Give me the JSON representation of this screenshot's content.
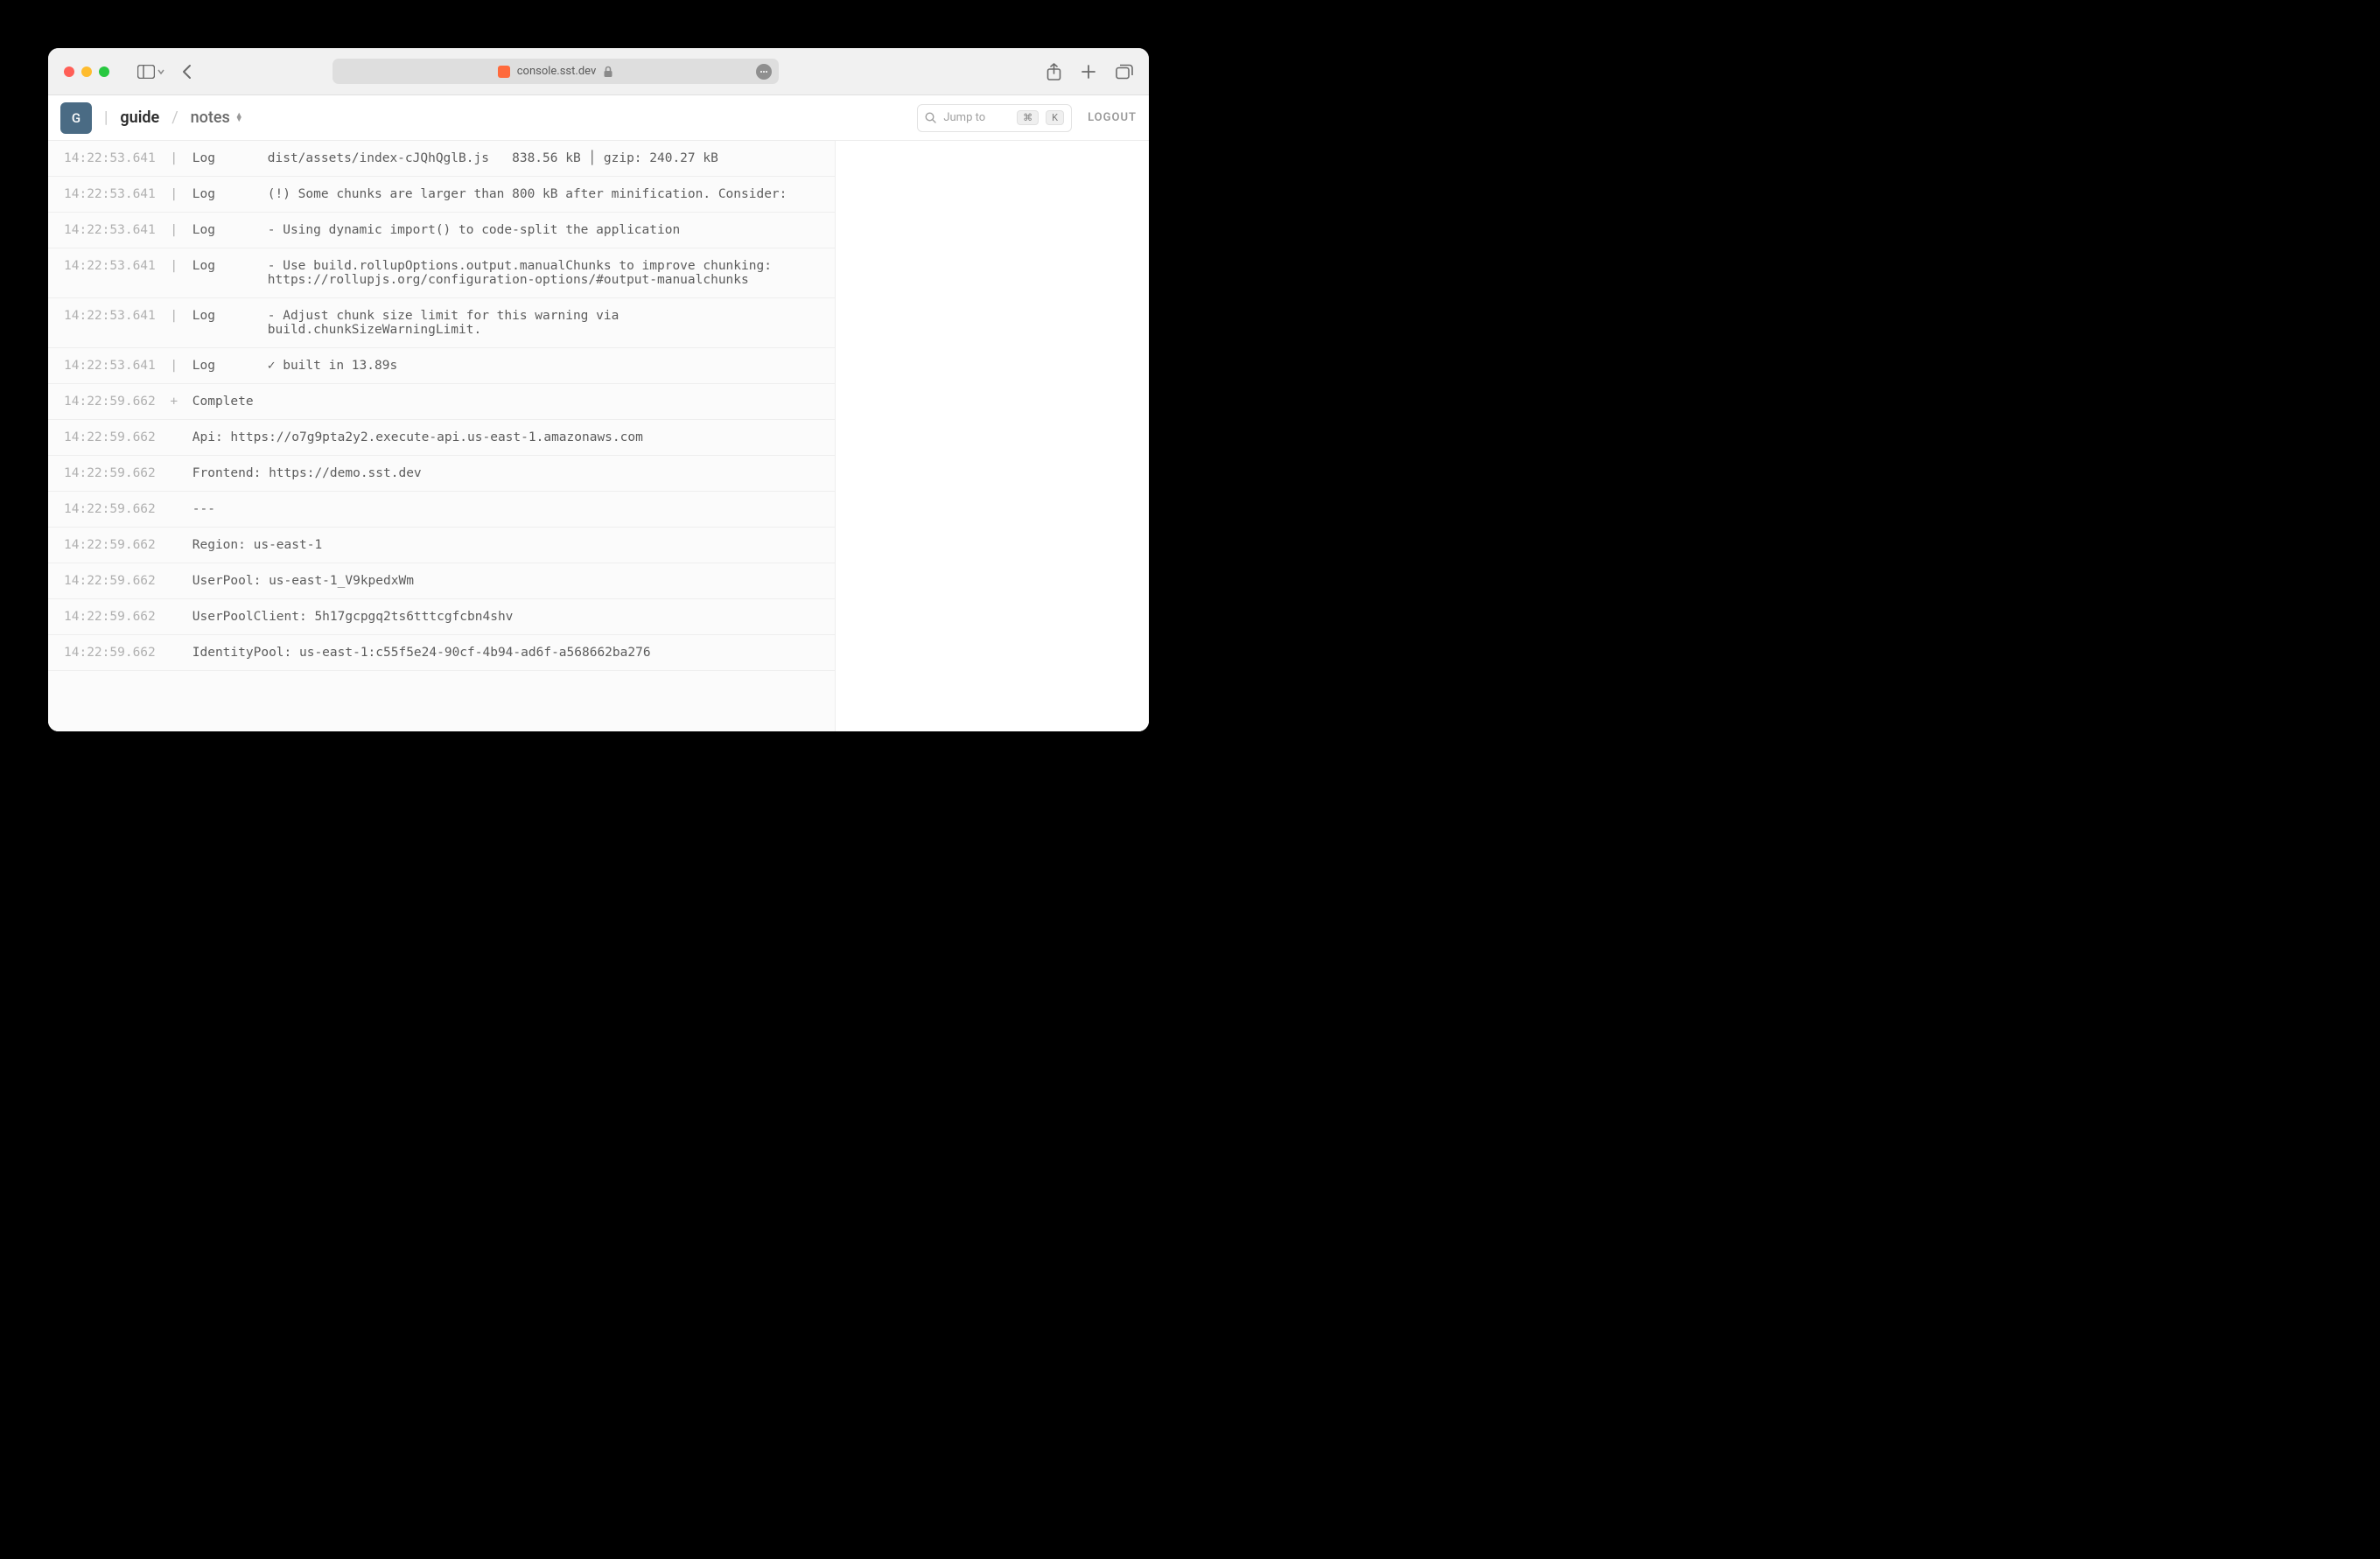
{
  "browser": {
    "url_display": "console.sst.dev"
  },
  "header": {
    "org_initial": "G",
    "breadcrumb": [
      "guide",
      "notes"
    ],
    "jump_label": "Jump to",
    "keycap_cmd": "⌘",
    "keycap_k": "K",
    "logout_label": "LOGOUT"
  },
  "logs": [
    {
      "ts": "14:22:53.641",
      "marker": "|",
      "level": "Log",
      "msg": "dist/assets/index-cJQhQglB.js   838.56 kB │ gzip: 240.27 kB"
    },
    {
      "ts": "14:22:53.641",
      "marker": "|",
      "level": "Log",
      "msg": "(!) Some chunks are larger than 800 kB after minification. Consider:"
    },
    {
      "ts": "14:22:53.641",
      "marker": "|",
      "level": "Log",
      "msg": "- Using dynamic import() to code-split the application"
    },
    {
      "ts": "14:22:53.641",
      "marker": "|",
      "level": "Log",
      "msg": "- Use build.rollupOptions.output.manualChunks to improve chunking: https://rollupjs.org/configuration-options/#output-manualchunks"
    },
    {
      "ts": "14:22:53.641",
      "marker": "|",
      "level": "Log",
      "msg": "- Adjust chunk size limit for this warning via build.chunkSizeWarningLimit."
    },
    {
      "ts": "14:22:53.641",
      "marker": "|",
      "level": "Log",
      "msg": "✓ built in 13.89s"
    },
    {
      "ts": "14:22:59.662",
      "marker": "+",
      "level": "Complete",
      "msg": ""
    },
    {
      "ts": "14:22:59.662",
      "marker": "",
      "level": "",
      "msg": "Api: https://o7g9pta2y2.execute-api.us-east-1.amazonaws.com"
    },
    {
      "ts": "14:22:59.662",
      "marker": "",
      "level": "",
      "msg": "Frontend: https://demo.sst.dev"
    },
    {
      "ts": "14:22:59.662",
      "marker": "",
      "level": "",
      "msg": "---"
    },
    {
      "ts": "14:22:59.662",
      "marker": "",
      "level": "",
      "msg": "Region: us-east-1"
    },
    {
      "ts": "14:22:59.662",
      "marker": "",
      "level": "",
      "msg": "UserPool: us-east-1_V9kpedxWm"
    },
    {
      "ts": "14:22:59.662",
      "marker": "",
      "level": "",
      "msg": "UserPoolClient: 5h17gcpgq2ts6tttcgfcbn4shv"
    },
    {
      "ts": "14:22:59.662",
      "marker": "",
      "level": "",
      "msg": "IdentityPool: us-east-1:c55f5e24-90cf-4b94-ad6f-a568662ba276"
    }
  ]
}
